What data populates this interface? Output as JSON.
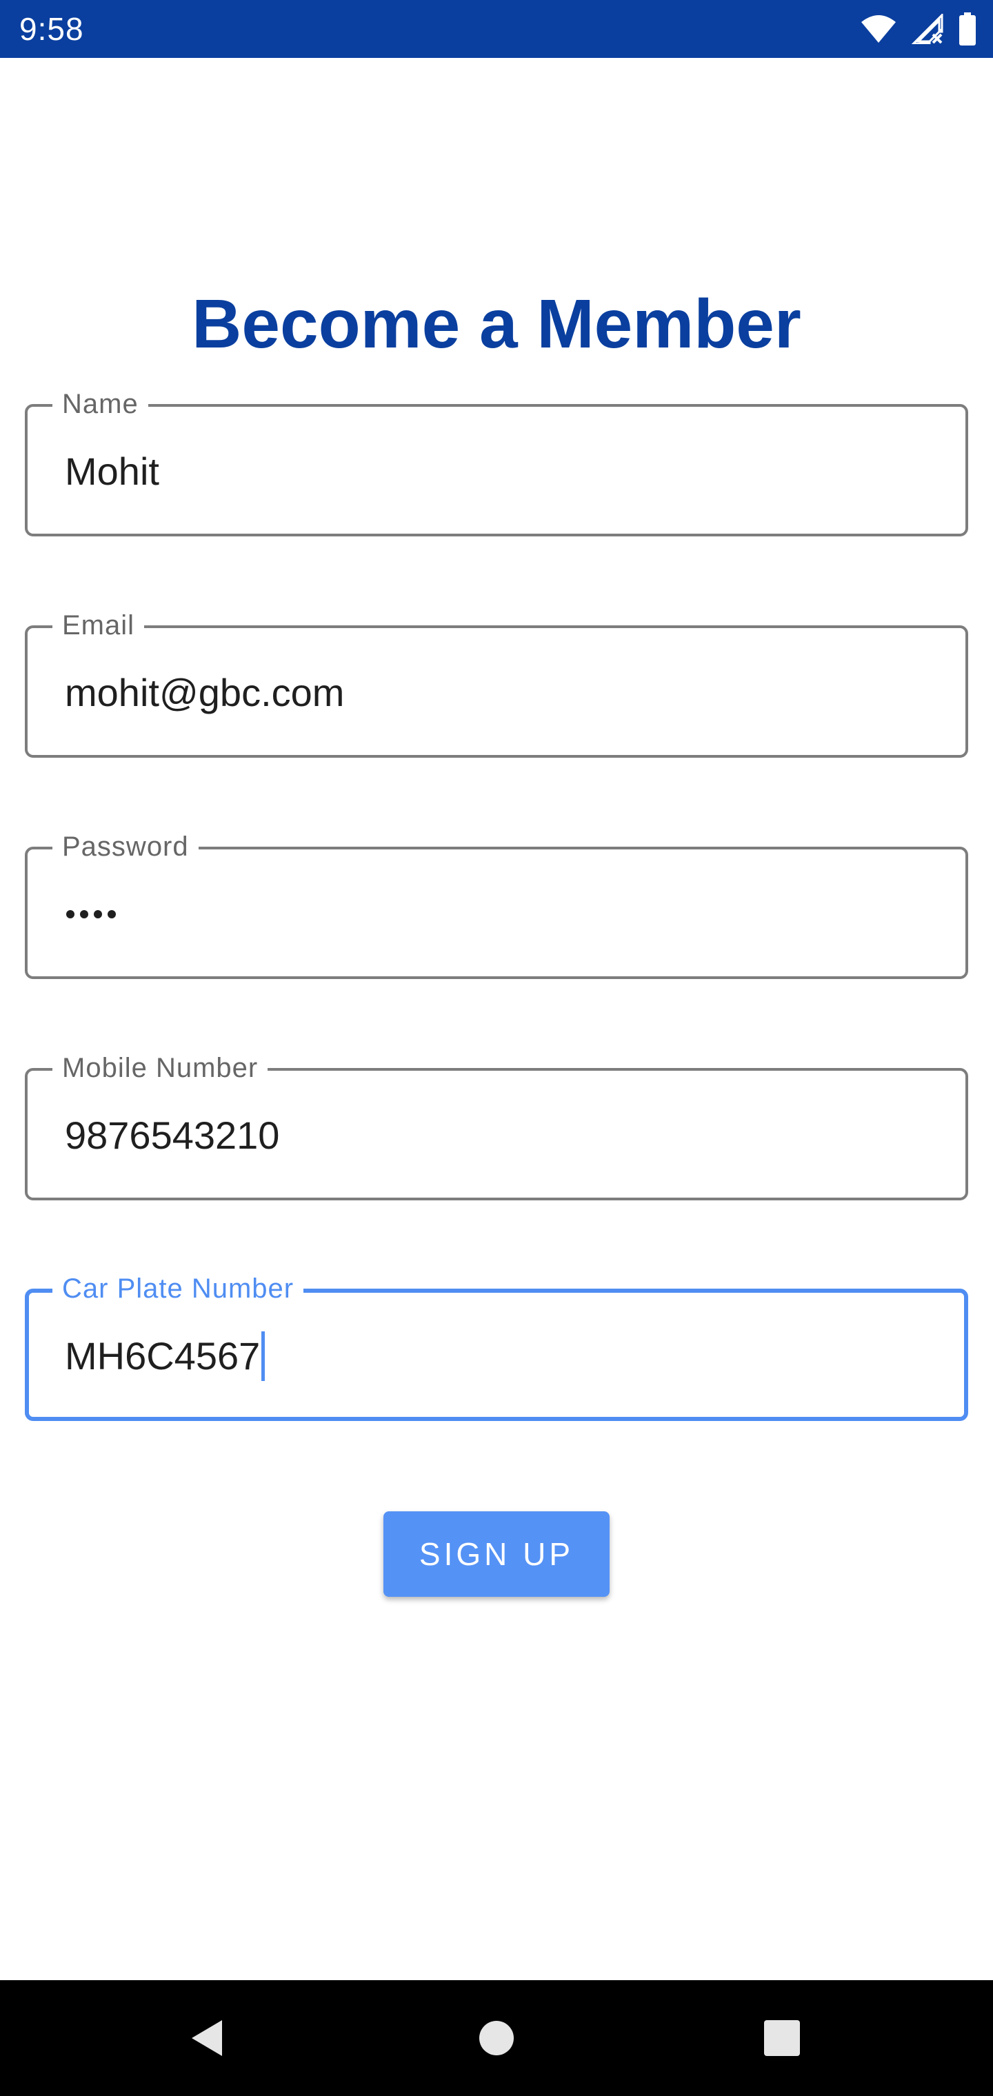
{
  "status_bar": {
    "time": "9:58",
    "background": "#0a3f9f",
    "icons": [
      "wifi-icon",
      "signal-no-data-icon",
      "battery-icon"
    ]
  },
  "page": {
    "title": "Become a Member",
    "title_color": "#0a3f9f"
  },
  "form": {
    "fields": [
      {
        "label": "Name",
        "value": "Mohit",
        "type": "text"
      },
      {
        "label": "Email",
        "value": "mohit@gbc.com",
        "type": "email"
      },
      {
        "label": "Password",
        "value": "••••",
        "type": "password",
        "length": 4
      },
      {
        "label": "Mobile Number",
        "value": "9876543210",
        "type": "tel"
      },
      {
        "label": "Car Plate Number",
        "value": "MH6C4567",
        "type": "text",
        "focused": true
      }
    ],
    "focus_color": "#4f8df2",
    "submit_label": "SIGN UP",
    "submit_color": "#5592f5"
  },
  "nav_bar": {
    "buttons": [
      "back-icon",
      "home-icon",
      "recents-icon"
    ]
  }
}
